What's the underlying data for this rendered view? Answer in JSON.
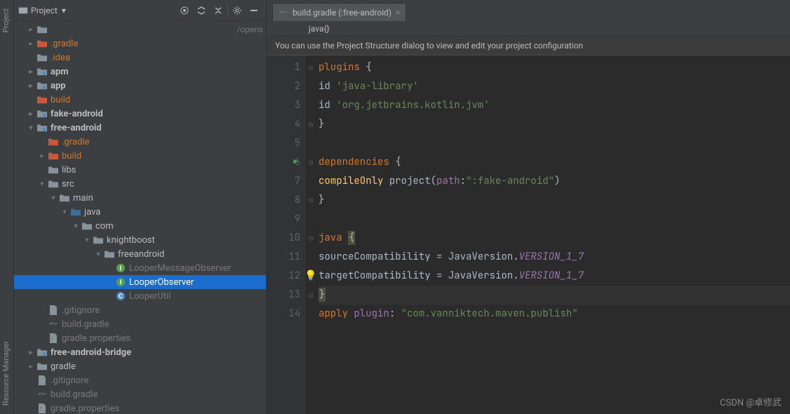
{
  "leftRail": {
    "top": "Project",
    "bottom": "Resource Manager"
  },
  "sidebar": {
    "title": "Project",
    "pathHint": "/opens",
    "tree": [
      {
        "level": 1,
        "arrow": "right",
        "icon": "folder",
        "label": "",
        "muted": true
      },
      {
        "level": 1,
        "arrow": "right",
        "icon": "folder-orange",
        "label": ".gradle",
        "orange": true
      },
      {
        "level": 1,
        "arrow": "none",
        "icon": "folder",
        "label": ".idea",
        "orange": true
      },
      {
        "level": 1,
        "arrow": "right",
        "icon": "folder-module",
        "label": "apm",
        "bold": true
      },
      {
        "level": 1,
        "arrow": "right",
        "icon": "folder-module",
        "label": "app",
        "bold": true
      },
      {
        "level": 1,
        "arrow": "none",
        "icon": "folder-orange",
        "label": "build",
        "orange": true
      },
      {
        "level": 1,
        "arrow": "right",
        "icon": "folder-module",
        "label": "fake-android",
        "bold": true
      },
      {
        "level": 1,
        "arrow": "down",
        "icon": "folder-module",
        "label": "free-android",
        "bold": true
      },
      {
        "level": 2,
        "arrow": "none",
        "icon": "folder-orange",
        "label": ".gradle",
        "orange": true
      },
      {
        "level": 2,
        "arrow": "right",
        "icon": "folder-orange",
        "label": "build",
        "orange": true
      },
      {
        "level": 2,
        "arrow": "none",
        "icon": "folder",
        "label": "libs"
      },
      {
        "level": 2,
        "arrow": "down",
        "icon": "folder",
        "label": "src"
      },
      {
        "level": 3,
        "arrow": "down",
        "icon": "folder",
        "label": "main"
      },
      {
        "level": 4,
        "arrow": "down",
        "icon": "folder-src",
        "label": "java"
      },
      {
        "level": 5,
        "arrow": "down",
        "icon": "folder",
        "label": "com"
      },
      {
        "level": 6,
        "arrow": "down",
        "icon": "folder",
        "label": "knightboost"
      },
      {
        "level": 7,
        "arrow": "down",
        "icon": "folder",
        "label": "freeandroid"
      },
      {
        "level": 8,
        "arrow": "none",
        "icon": "interface",
        "label": "LooperMessageObserver",
        "muted": true
      },
      {
        "level": 8,
        "arrow": "none",
        "icon": "interface",
        "label": "LooperObserver",
        "selected": true
      },
      {
        "level": 8,
        "arrow": "none",
        "icon": "class",
        "label": "LooperUtil",
        "muted": true
      },
      {
        "level": 2,
        "arrow": "none",
        "icon": "file",
        "label": ".gitignore",
        "muted": true
      },
      {
        "level": 2,
        "arrow": "none",
        "icon": "gradle",
        "label": "build.gradle",
        "muted": true
      },
      {
        "level": 2,
        "arrow": "none",
        "icon": "properties",
        "label": "gradle.properties",
        "muted": true
      },
      {
        "level": 1,
        "arrow": "right",
        "icon": "folder-module",
        "label": "free-android-bridge",
        "bold": true
      },
      {
        "level": 1,
        "arrow": "right",
        "icon": "folder",
        "label": "gradle"
      },
      {
        "level": 1,
        "arrow": "none",
        "icon": "file",
        "label": ".gitignore",
        "muted": true
      },
      {
        "level": 1,
        "arrow": "none",
        "icon": "gradle",
        "label": "build.gradle",
        "muted": true
      },
      {
        "level": 1,
        "arrow": "none",
        "icon": "properties",
        "label": "gradle.properties",
        "muted": true
      }
    ]
  },
  "tab": {
    "label": "build.gradle (:free-android)"
  },
  "breadcrumb": "java{}",
  "banner": "You can use the Project Structure dialog to view and edit your project configuration",
  "code": {
    "lines": [
      {
        "n": 1,
        "html": "<span class='kw'>plugins</span> <span class='txt'>{</span>"
      },
      {
        "n": 2,
        "html": "    <span class='txt'>id </span><span class='str'>'java-library'</span>"
      },
      {
        "n": 3,
        "html": "    <span class='txt'>id </span><span class='str'>'org.jetbrains.kotlin.jvm'</span>"
      },
      {
        "n": 4,
        "html": "<span class='txt'>}</span>"
      },
      {
        "n": 5,
        "html": ""
      },
      {
        "n": 6,
        "html": "<span class='kw'>dependencies</span> <span class='txt'>{</span>",
        "run": true
      },
      {
        "n": 7,
        "html": "    <span class='fn'>compileOnly</span> <span class='txt'>project(</span><span class='param'>path</span><span class='txt'>:</span><span class='str'>\":fake-android\"</span><span class='txt'>)</span>"
      },
      {
        "n": 8,
        "html": "<span class='txt'>}</span>"
      },
      {
        "n": 9,
        "html": ""
      },
      {
        "n": 10,
        "html": "<span class='kw'>java</span> <span class='txt brace-hl'>{</span>"
      },
      {
        "n": 11,
        "html": "    <span class='txt'>sourceCompatibility = JavaVersion.</span><span class='const'>VERSION_1_7</span>"
      },
      {
        "n": 12,
        "html": "    <span class='txt'>targetCompatibility = JavaVersion.</span><span class='const'>VERSION_1_7</span>",
        "bulb": true
      },
      {
        "n": 13,
        "html": "<span class='txt brace-hl'>}</span>",
        "hl": true
      },
      {
        "n": 14,
        "html": "<span class='kw'>apply</span> <span class='param'>plugin</span><span class='txt'>: </span><span class='str'>\"com.vanniktech.maven.publish\"</span>"
      }
    ]
  },
  "watermark": "CSDN @卓修武"
}
